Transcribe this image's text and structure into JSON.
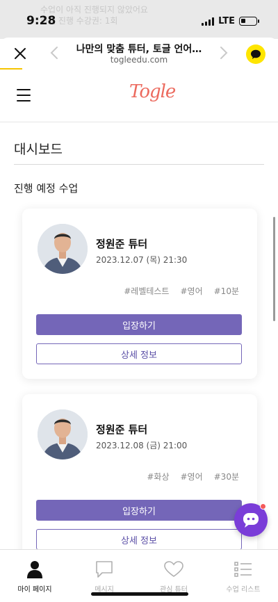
{
  "status_bar": {
    "time": "9:28",
    "network": "LTE",
    "ghost_text_line1": "수업이 아직 진행되지 않았어요",
    "ghost_text_line2": "현재 진행 수강권: 1회"
  },
  "browser": {
    "title": "나만의 맞춤 튜터, 토글 언어…",
    "url": "togleedu.com"
  },
  "site": {
    "logo": "Togle"
  },
  "page": {
    "title": "대시보드",
    "section_title": "진행 예정 수업"
  },
  "lessons": [
    {
      "tutor": "정원준 튜터",
      "datetime": "2023.12.07 (목) 21:30",
      "tags": [
        "#레벨테스트",
        "#영어",
        "#10분"
      ],
      "enter_label": "입장하기",
      "detail_label": "상세 정보"
    },
    {
      "tutor": "정원준 튜터",
      "datetime": "2023.12.08 (금) 21:00",
      "tags": [
        "#화상",
        "#영어",
        "#30분"
      ],
      "enter_label": "입장하기",
      "detail_label": "상세 정보"
    }
  ],
  "bottom_nav": [
    {
      "label": "마이 페이지",
      "icon": "person-icon",
      "active": true
    },
    {
      "label": "메시지",
      "icon": "message-icon",
      "active": false
    },
    {
      "label": "관심 튜터",
      "icon": "heart-icon",
      "active": false
    },
    {
      "label": "수업 리스트",
      "icon": "list-icon",
      "active": false
    }
  ],
  "colors": {
    "accent": "#7466b8",
    "logo": "#ec6a5e",
    "kakao": "#fee500",
    "chat_fab": "#7a3dd8"
  }
}
